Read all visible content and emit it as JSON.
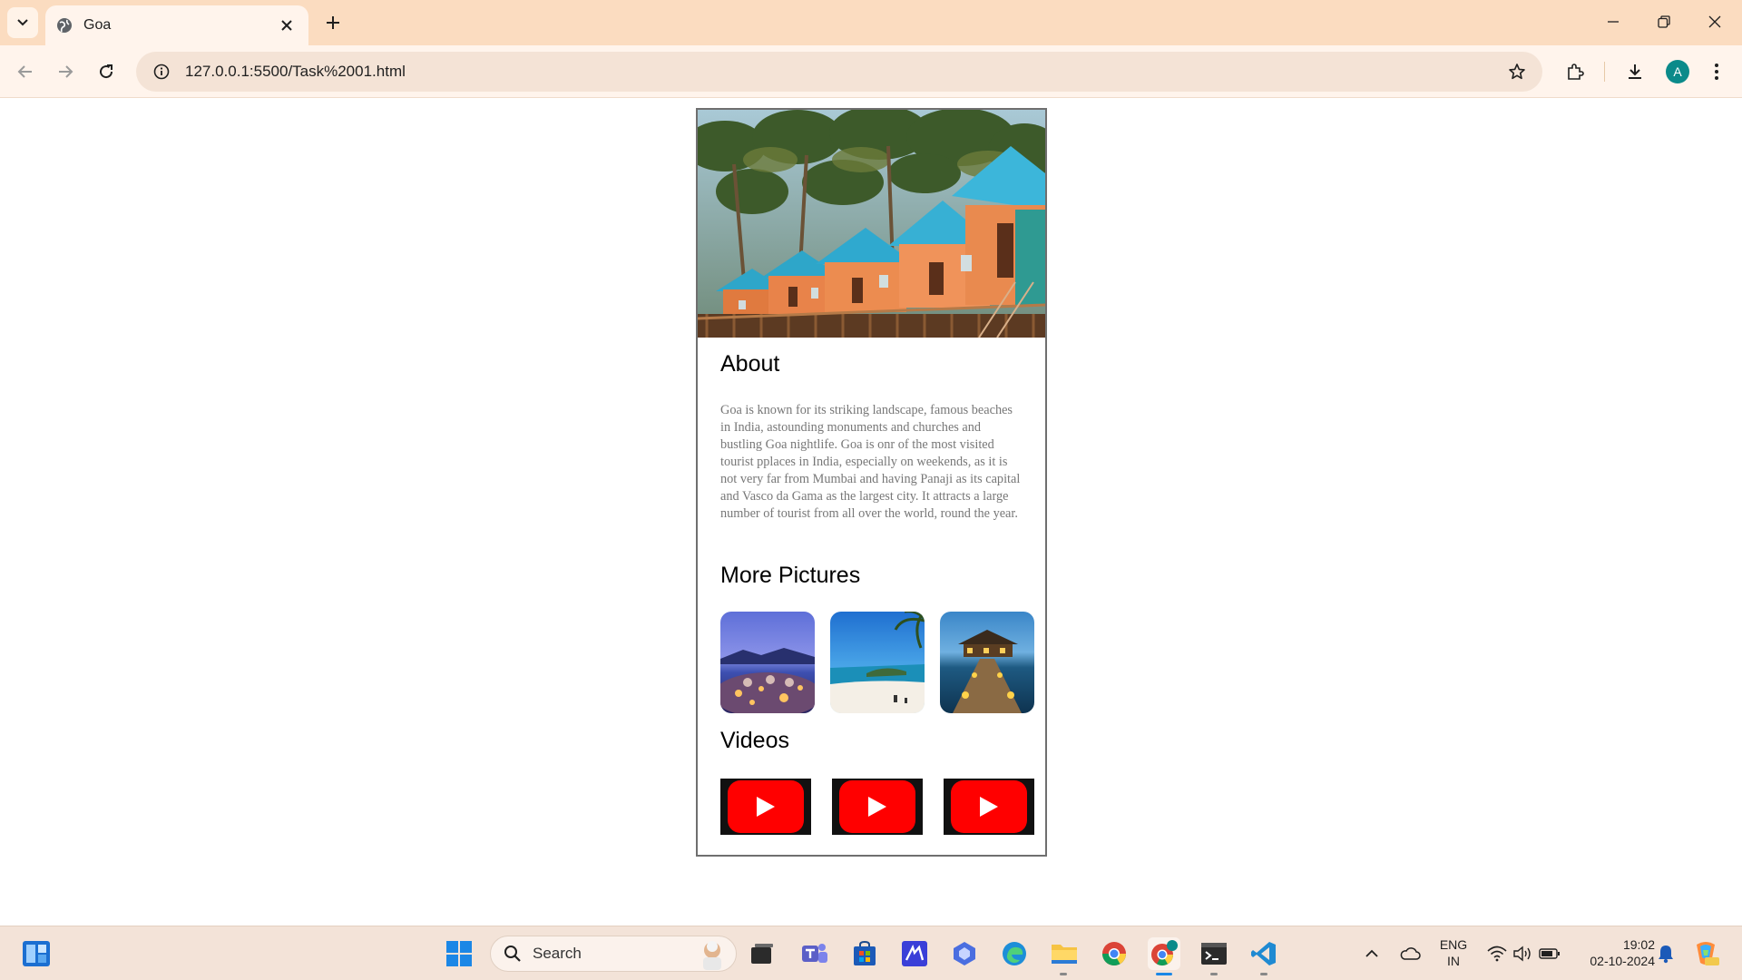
{
  "browser": {
    "tab_title": "Goa",
    "url": "127.0.0.1:5500/Task%2001.html",
    "profile_initial": "A"
  },
  "page": {
    "about_heading": "About",
    "about_text": "Goa is known for its striking landscape, famous beaches in India, astounding monuments and churches and bustling Goa nightlife. Goa is onr of the most visited tourist pplaces in India, especially on weekends, as it is not very far from Mumbai and having Panaji as its capital and Vasco da Gama as the largest city. It attracts a large number of tourist from all over the world, round the year.",
    "pictures_heading": "More Pictures",
    "videos_heading": "Videos",
    "pictures": [
      "beach-night-party-photo",
      "tropical-beach-photo",
      "resort-walkway-photo"
    ],
    "videos": [
      "youtube-video-1",
      "youtube-video-2",
      "youtube-video-3"
    ]
  },
  "taskbar": {
    "search_placeholder": "Search",
    "language": "ENG",
    "region": "IN",
    "time": "19:02",
    "date": "02-10-2024"
  },
  "colors": {
    "tabbar": "#fbdcc0",
    "toolbar": "#fff4ec",
    "youtube_red": "#ff0000",
    "body_text": "#777777"
  }
}
